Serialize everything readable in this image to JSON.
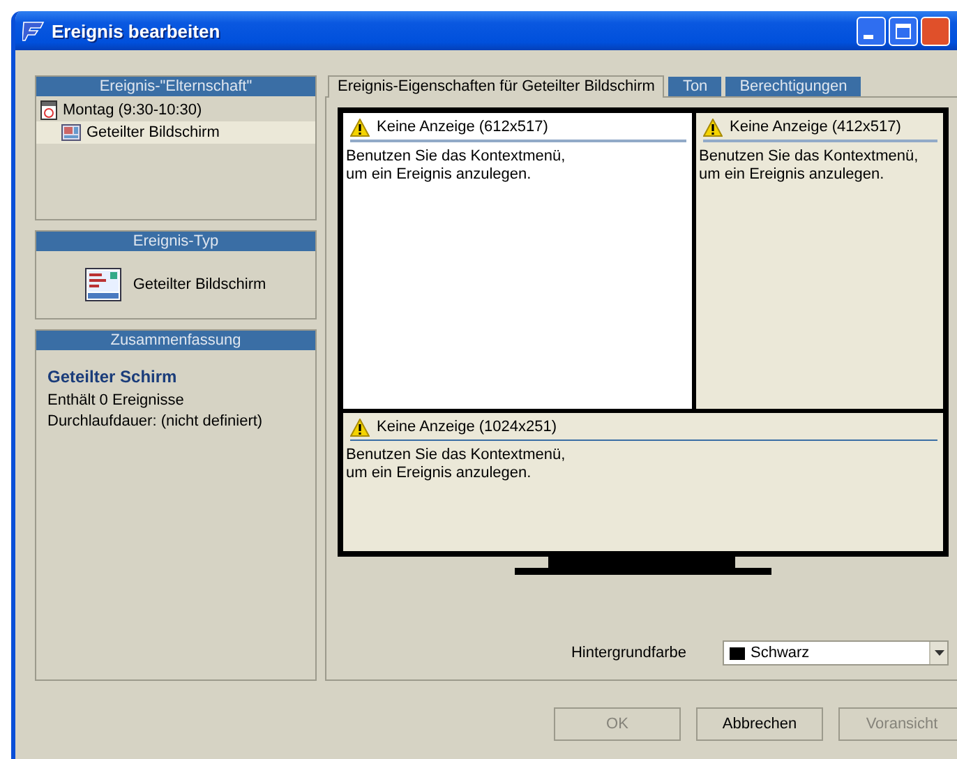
{
  "window": {
    "title": "Ereignis bearbeiten"
  },
  "parent_panel": {
    "heading": "Ereignis-\"Elternschaft\"",
    "tree": [
      {
        "label": "Montag (9:30-10:30)",
        "selected": false,
        "children": [
          {
            "label": "Geteilter Bildschirm",
            "selected": true
          }
        ]
      }
    ]
  },
  "type_panel": {
    "heading": "Ereignis-Typ",
    "label": "Geteilter Bildschirm"
  },
  "summary_panel": {
    "heading": "Zusammenfassung",
    "title": "Geteilter Schirm",
    "lines": [
      "Enthält 0 Ereignisse",
      "Durchlaufdauer: (nicht definiert)"
    ]
  },
  "tabs": [
    {
      "label": "Ereignis-Eigenschaften für Geteilter Bildschirm",
      "selected": true
    },
    {
      "label": "Ton",
      "selected": false
    },
    {
      "label": "Berechtigungen",
      "selected": false
    }
  ],
  "screen_layout": {
    "panes": [
      {
        "title": "Keine Anzeige (612x517)",
        "message": "Benutzen Sie das Kontextmenü,\num ein Ereignis anzulegen.",
        "selected": true
      },
      {
        "title": "Keine Anzeige (412x517)",
        "message": "Benutzen Sie das Kontextmenü,\num ein Ereignis anzulegen.",
        "selected": false
      },
      {
        "title": "Keine Anzeige (1024x251)",
        "message": "Benutzen Sie das Kontextmenü,\num ein Ereignis anzulegen.",
        "selected": false
      }
    ]
  },
  "background_color": {
    "label": "Hintergrundfarbe",
    "value": "Schwarz",
    "color": "#000000"
  },
  "buttons": [
    {
      "label": "OK",
      "disabled": true
    },
    {
      "label": "Abbrechen",
      "disabled": false
    },
    {
      "label": "Voransicht",
      "disabled": true
    }
  ]
}
